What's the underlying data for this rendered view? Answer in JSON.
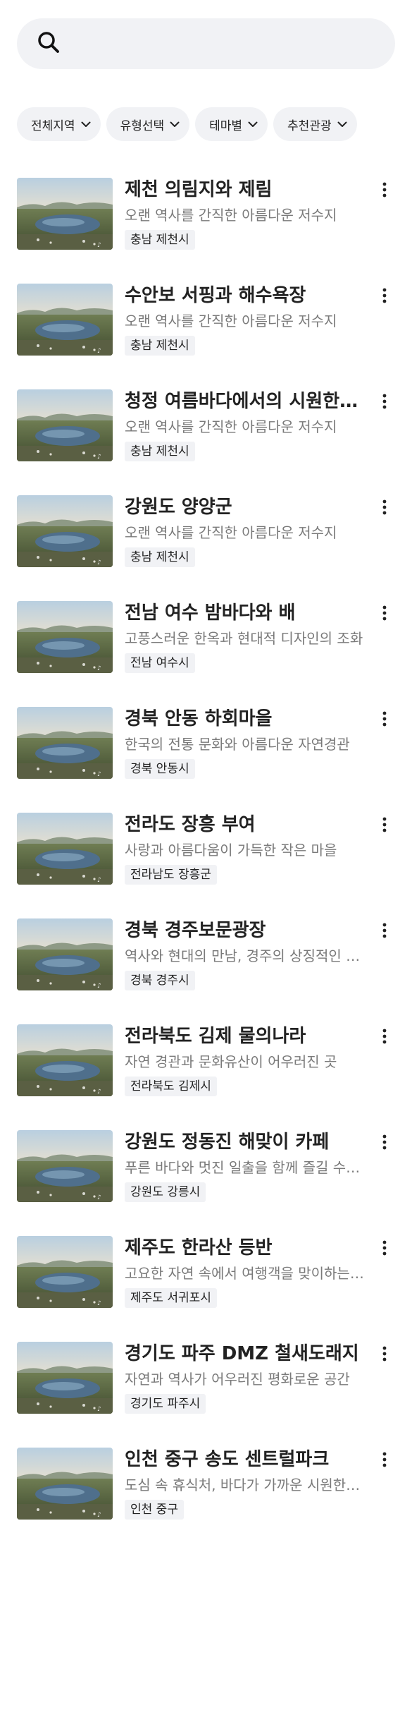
{
  "search": {
    "placeholder": "",
    "icon": "search-icon"
  },
  "filters": [
    {
      "label": "전체지역"
    },
    {
      "label": "유형선택"
    },
    {
      "label": "테마별"
    },
    {
      "label": "추천관광"
    }
  ],
  "items": [
    {
      "title": "제천 의림지와 제림",
      "desc": "오랜 역사를 간직한 아름다운 저수지",
      "tag": "충남 제천시"
    },
    {
      "title": "수안보 서핑과 해수욕장",
      "desc": "오랜 역사를 간직한 아름다운 저수지",
      "tag": "충남 제천시"
    },
    {
      "title": "청정 여름바다에서의 시원한 휴가",
      "desc": "오랜 역사를 간직한 아름다운 저수지",
      "tag": "충남 제천시"
    },
    {
      "title": "강원도 양양군",
      "desc": "오랜 역사를 간직한 아름다운 저수지",
      "tag": "충남 제천시"
    },
    {
      "title": "전남 여수 밤바다와 배",
      "desc": "고풍스러운 한옥과 현대적 디자인의 조화",
      "tag": "전남 여수시"
    },
    {
      "title": "경북 안동 하회마을",
      "desc": "한국의 전통 문화와 아름다운 자연경관",
      "tag": "경북 안동시"
    },
    {
      "title": "전라도 장흥 부여",
      "desc": "사랑과 아름다움이 가득한 작은 마을",
      "tag": "전라남도 장흥군"
    },
    {
      "title": "경북 경주보문광장",
      "desc": "역사와 현대의 만남, 경주의 상징적인 장소",
      "tag": "경북 경주시"
    },
    {
      "title": "전라북도 김제 물의나라",
      "desc": "자연 경관과 문화유산이 어우러진 곳",
      "tag": "전라북도 김제시"
    },
    {
      "title": "강원도 정동진 해맞이 카페",
      "desc": "푸른 바다와 멋진 일출을 함께 즐길 수 있는 곳",
      "tag": "강원도 강릉시"
    },
    {
      "title": "제주도 한라산 등반",
      "desc": "고요한 자연 속에서 여행객을 맞이하는 명소",
      "tag": "제주도 서귀포시"
    },
    {
      "title": "경기도 파주 DMZ 철새도래지",
      "desc": "자연과 역사가 어우러진 평화로운 공간",
      "tag": "경기도 파주시"
    },
    {
      "title": "인천 중구 송도 센트럴파크",
      "desc": "도심 속 휴식처, 바다가 가까운 시원한 공원",
      "tag": "인천 중구"
    }
  ]
}
